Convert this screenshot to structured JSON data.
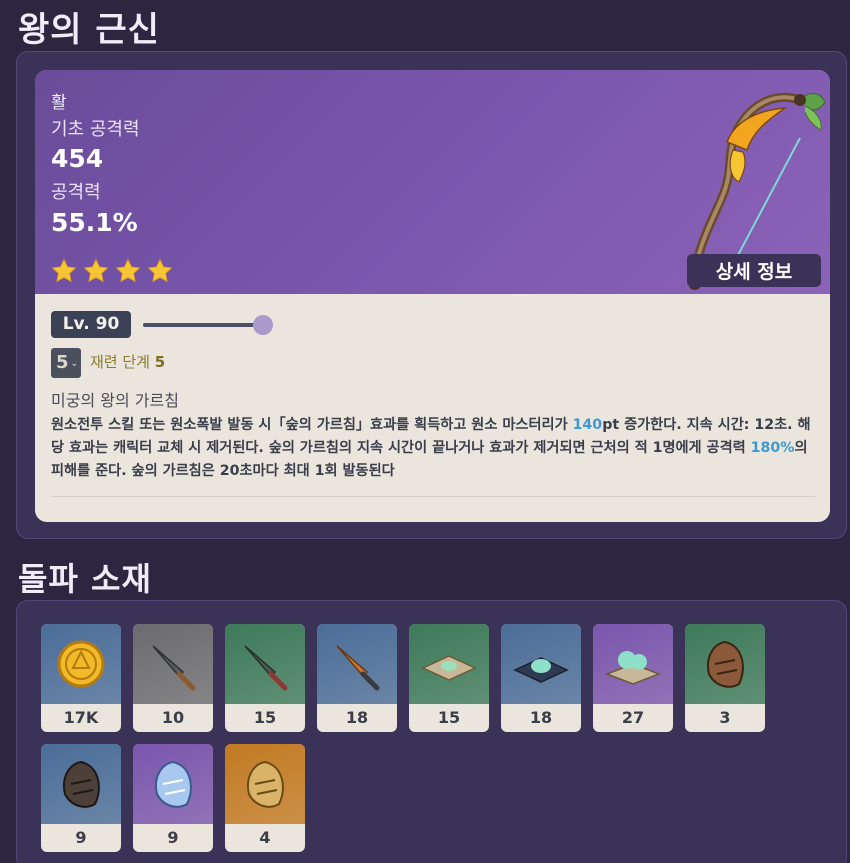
{
  "page": {
    "title": "왕의 근신",
    "section_title": "돌파 소재"
  },
  "weapon": {
    "type": "활",
    "base_atk_label": "기초 공격력",
    "base_atk_value": "454",
    "sub_stat_label": "공격력",
    "sub_stat_value": "55.1%",
    "rarity": 4,
    "detail_button": "상세 정보",
    "level_label": "Lv. 90",
    "refine_value": "5",
    "refine_label": "재련 단계",
    "refine_level": "5",
    "passive_name": "미궁의 왕의 가르침",
    "passive_desc": {
      "p1": "원소전투 스킬 또는 원소폭발 발동 시「숲의 가르침」효과를 획득하고 원소 마스터리가 ",
      "v1": "140",
      "p2": "pt 증가한다. 지속 시간: 12초. 해당 효과는 캐릭터 교체 시 제거된다. 숲의 가르침의 지속 시간이 끝나거나 효과가 제거되면 근처의 적 1명에게 공격력 ",
      "v2": "180%",
      "p3": "의 피해를 준다. 숲의 가르침은 20초마다 최대 1회 발동된다"
    }
  },
  "materials": [
    {
      "icon": "mora-coin-icon",
      "count": "17K",
      "bg": "#4a6d99"
    },
    {
      "icon": "gray-dagger-icon",
      "count": "10",
      "bg": "#6b6b70"
    },
    {
      "icon": "green-dagger-icon",
      "count": "15",
      "bg": "#3d7a5a"
    },
    {
      "icon": "blue-dagger-icon",
      "count": "18",
      "bg": "#4a6d99"
    },
    {
      "icon": "green-tray-icon",
      "count": "15",
      "bg": "#3d7a5a"
    },
    {
      "icon": "blue-tray-icon",
      "count": "18",
      "bg": "#4a6d99"
    },
    {
      "icon": "purple-tray-icon",
      "count": "27",
      "bg": "#7a56ad"
    },
    {
      "icon": "green-shell-icon",
      "count": "3",
      "bg": "#3d7a5a"
    },
    {
      "icon": "blue-shell-icon",
      "count": "9",
      "bg": "#4a6d99"
    },
    {
      "icon": "purple-crystal-shell-icon",
      "count": "9",
      "bg": "#7a56ad"
    },
    {
      "icon": "gold-shell-icon",
      "count": "4",
      "bg": "#c27a22"
    }
  ]
}
